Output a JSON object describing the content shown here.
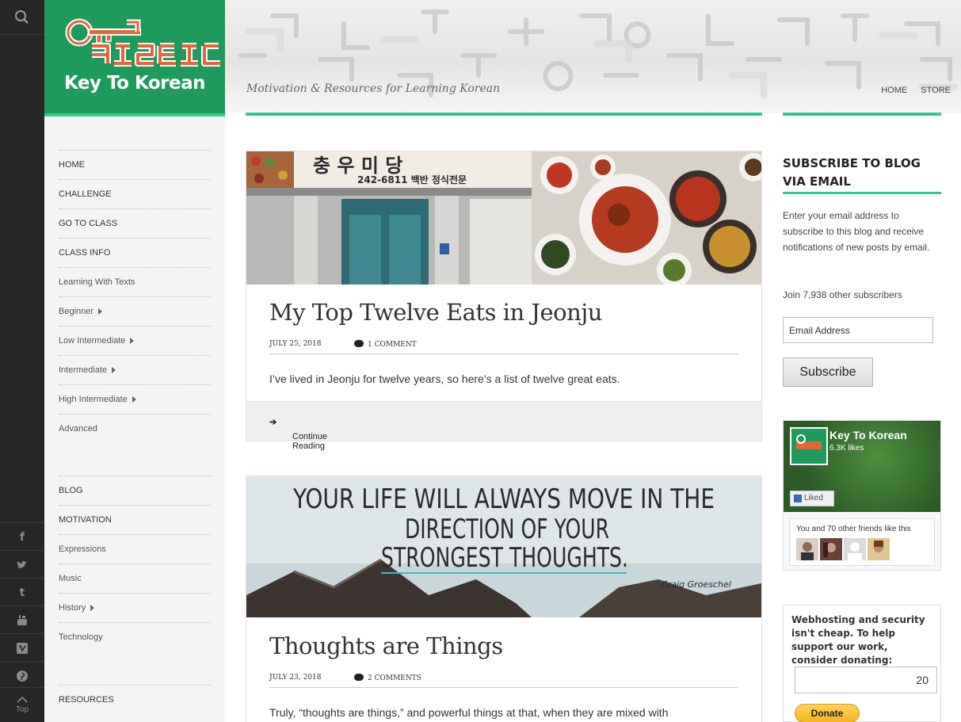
{
  "brand": {
    "logo_text": "ㅋㅇㄹㅌㅇㄷ",
    "title": "Key To Korean",
    "green": "#1f9a5d",
    "accent": "#2ecc8e"
  },
  "header": {
    "tagline": "Motivation & Resources for Learning Korean",
    "nav": [
      "HOME",
      "STORE"
    ]
  },
  "rail": {
    "icons": [
      "search-icon",
      "facebook-icon",
      "twitter-icon",
      "tumblr-icon",
      "youtube-icon",
      "vimeo-icon",
      "pinterest-icon",
      "chevron-up-icon"
    ],
    "top_label": "Top"
  },
  "menu": {
    "group1": [
      {
        "label": "HOME",
        "submenu": false
      },
      {
        "label": "CHALLENGE",
        "submenu": false
      },
      {
        "label": "GO TO CLASS",
        "submenu": false
      },
      {
        "label": "CLASS INFO",
        "submenu": false
      },
      {
        "label": "Learning With Texts",
        "submenu": false
      },
      {
        "label": "Beginner",
        "submenu": true
      },
      {
        "label": "Low Intermediate",
        "submenu": true
      },
      {
        "label": "Intermediate",
        "submenu": true
      },
      {
        "label": "High Intermediate",
        "submenu": true
      },
      {
        "label": "Advanced",
        "submenu": false
      }
    ],
    "group2": [
      {
        "label": "BLOG",
        "submenu": false
      },
      {
        "label": "MOTIVATION",
        "submenu": false
      },
      {
        "label": "Expressions",
        "submenu": false
      },
      {
        "label": "Music",
        "submenu": false
      },
      {
        "label": "History",
        "submenu": true
      },
      {
        "label": "Technology",
        "submenu": false
      }
    ],
    "group3": [
      {
        "label": "RESOURCES",
        "submenu": false
      }
    ]
  },
  "posts": [
    {
      "sign_text": "242-6811 백반  정식전문",
      "title": "My Top Twelve Eats in Jeonju",
      "date": "JULY 25, 2018",
      "comments": "1 COMMENT",
      "excerpt": "I’ve lived in Jeonju for twelve years, so here’s a list of twelve great eats.",
      "more": "Continue Reading"
    },
    {
      "quote_lines": [
        "YOUR LIFE WILL ALWAYS MOVE IN THE",
        "DIRECTION OF YOUR",
        "STRONGEST THOUGHTS."
      ],
      "quote_author": "-Craig Groeschel",
      "title": "Thoughts are Things",
      "date": "JULY 23, 2018",
      "comments": "2 COMMENTS",
      "excerpt": "Truly, “thoughts are things,” and powerful things at that, when they are mixed with"
    }
  ],
  "sidebar": {
    "subscribe_heading": "SUBSCRIBE TO BLOG VIA EMAIL",
    "subscribe_text": "Enter your email address to subscribe to this blog and receive notifications of new posts by email.",
    "subscribers": "Join 7,938 other subscribers",
    "email_placeholder": "Email Address",
    "subscribe_button": "Subscribe",
    "facebook": {
      "name": "Key To Korean",
      "likes": "6.3K likes",
      "liked": "Liked",
      "friends": "You and 70 other friends like this"
    },
    "donate": {
      "text": "Webhosting and security isn't cheap. To help support our work, consider donating:",
      "amount": "20",
      "button": "Donate"
    }
  }
}
